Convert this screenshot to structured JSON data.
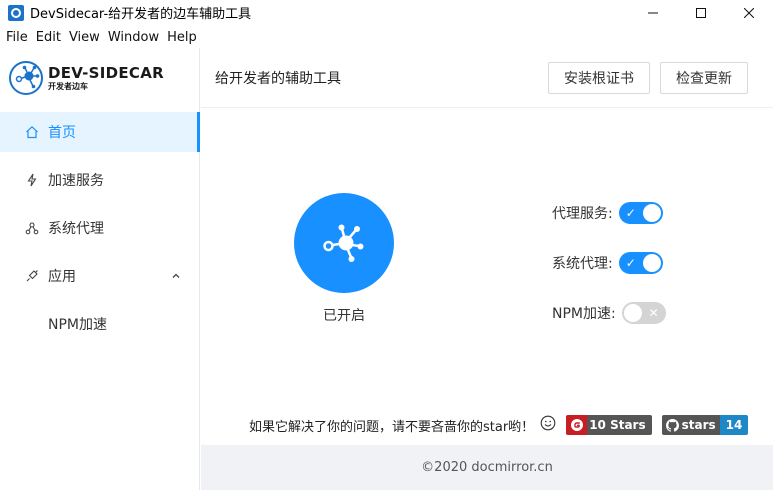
{
  "window": {
    "title": "DevSidecar-给开发者的边车辅助工具",
    "controls": {
      "minimize": "—",
      "maximize": "☐",
      "close": "✕"
    }
  },
  "menubar": [
    "File",
    "Edit",
    "View",
    "Window",
    "Help"
  ],
  "logo": {
    "title": "DEV-SIDECAR",
    "subtitle": "开发者边车"
  },
  "sidebar": {
    "items": [
      {
        "label": "首页",
        "icon": "home-icon",
        "active": true
      },
      {
        "label": "加速服务",
        "icon": "thunderbolt-icon"
      },
      {
        "label": "系统代理",
        "icon": "deployment-unit-icon"
      },
      {
        "label": "应用",
        "icon": "api-icon",
        "expanded": true
      },
      {
        "label": "NPM加速",
        "sub": true
      }
    ]
  },
  "header": {
    "title": "给开发者的辅助工具",
    "install_cert": "安装根证书",
    "check_update": "检查更新"
  },
  "main": {
    "power_label": "已开启",
    "switches": [
      {
        "label": "代理服务:",
        "on": true,
        "mark": "✓"
      },
      {
        "label": "系统代理:",
        "on": true,
        "mark": "✓"
      },
      {
        "label": "NPM加速:",
        "on": false,
        "mark": "✕"
      }
    ],
    "star_text": "如果它解决了你的问题，请不要吝啬你的star哟！",
    "badges": {
      "gitee_count": "10 Stars",
      "github_label": "stars",
      "github_count": "14"
    }
  },
  "footer": {
    "text": "©2020 docmirror.cn"
  },
  "colors": {
    "accent": "#1890ff",
    "switch_off": "#d4d4d4",
    "footer_bg": "#f0f2f5"
  }
}
